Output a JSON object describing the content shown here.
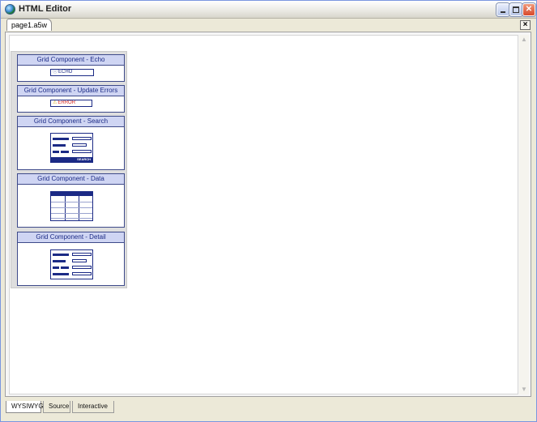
{
  "window": {
    "title": "HTML Editor",
    "icon": "globe-icon",
    "controls": [
      "minimize-icon",
      "maximize-icon",
      "close-icon"
    ]
  },
  "document_tab": {
    "label": "page1.a5w",
    "close_glyph": "×"
  },
  "palette": {
    "components": [
      {
        "title": "Grid Component - Echo",
        "preview_text": "ECHO"
      },
      {
        "title": "Grid Component - Update Errors",
        "preview_text": "ERROR"
      },
      {
        "title": "Grid Component - Search",
        "preview_text": "SEARCH"
      },
      {
        "title": "Grid Component - Data"
      },
      {
        "title": "Grid Component - Detail"
      }
    ]
  },
  "view_tabs": [
    {
      "label": "WYSIWYG",
      "active": true
    },
    {
      "label": "Source",
      "active": false
    },
    {
      "label": "Interactive",
      "active": false
    }
  ],
  "colors": {
    "accent": "#1b2a85",
    "component_header": "#cfd5f3",
    "error": "#d0201d"
  }
}
